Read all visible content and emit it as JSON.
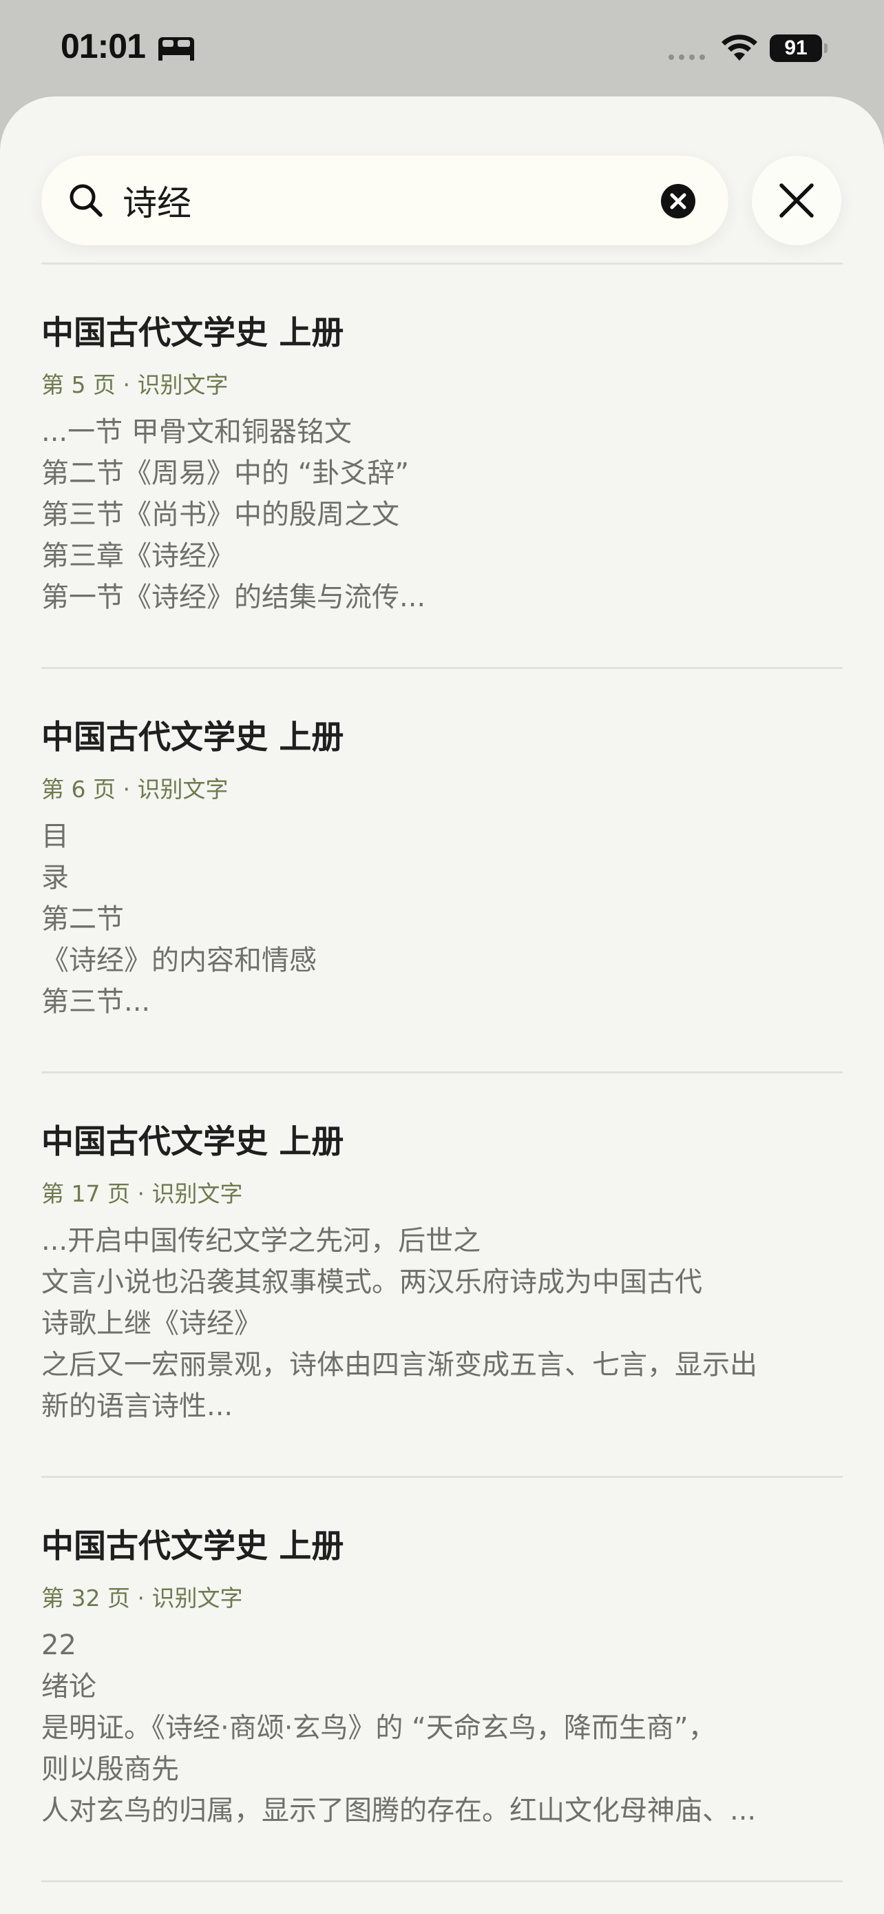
{
  "status_bar": {
    "time": "01:01",
    "battery": "91",
    "icons": [
      "bed-icon",
      "signal-icon",
      "wifi-icon",
      "battery-icon"
    ]
  },
  "search": {
    "query": "诗经",
    "icons": [
      "search-icon",
      "clear-icon",
      "close-icon"
    ]
  },
  "results": [
    {
      "title": "中国古代文学史 上册",
      "meta": "第 5 页 · 识别文字",
      "lines": [
        "...一节 甲骨文和铜器铭文",
        "第二节《周易》中的 “卦爻辞”",
        "第三节《尚书》中的殷周之文",
        "第三章《诗经》",
        "第一节《诗经》的结集与流传..."
      ]
    },
    {
      "title": "中国古代文学史 上册",
      "meta": "第 6 页 · 识别文字",
      "lines": [
        "目",
        "录",
        "第二节",
        "《诗经》的内容和情感",
        "第三节..."
      ]
    },
    {
      "title": "中国古代文学史 上册",
      "meta": "第 17 页 · 识别文字",
      "lines": [
        "...开启中国传纪文学之先河，后世之",
        "文言小说也沿袭其叙事模式。两汉乐府诗成为中国古代",
        "诗歌上继《诗经》",
        "之后又一宏丽景观，诗体由四言渐变成五言、七言，显示出",
        "新的语言诗性..."
      ]
    },
    {
      "title": "中国古代文学史 上册",
      "meta": "第 32 页 · 识别文字",
      "lines": [
        "22",
        "绪论",
        "是明证。《诗经·商颂·玄鸟》的 “天命玄鸟，降而生商”，",
        "则以殷商先",
        "人对玄鸟的归属，显示了图腾的存在。红山文化母神庙、..."
      ]
    }
  ]
}
